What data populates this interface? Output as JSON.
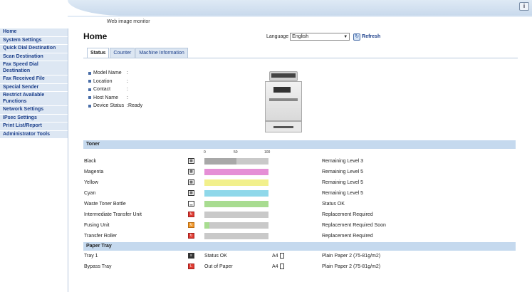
{
  "header": {
    "title": "Web image monitor",
    "help": "i"
  },
  "sidebar": {
    "items": [
      {
        "label": "Home"
      },
      {
        "label": "System Settings"
      },
      {
        "label": "Quick Dial Destination"
      },
      {
        "label": "Scan Destination"
      },
      {
        "label": "Fax Speed Dial Destination"
      },
      {
        "label": "Fax Received File"
      },
      {
        "label": "Special Sender"
      },
      {
        "label": "Restrict Available Functions"
      },
      {
        "label": "Network Settings"
      },
      {
        "label": "IPsec Settings"
      },
      {
        "label": "Print List/Report"
      },
      {
        "label": "Administrator Tools"
      }
    ]
  },
  "page": {
    "title": "Home"
  },
  "language": {
    "label": "Language",
    "selected": "English",
    "refresh": "Refresh"
  },
  "tabs": [
    {
      "label": "Status"
    },
    {
      "label": "Counter"
    },
    {
      "label": "Machine Information"
    }
  ],
  "device": {
    "model_name_label": "Model Name",
    "location_label": "Location",
    "contact_label": "Contact",
    "host_name_label": "Host Name",
    "device_status_label": "Device Status",
    "device_status_value": ":Ready"
  },
  "toner": {
    "header": "Toner",
    "scale": [
      "0",
      "50",
      "100"
    ],
    "rows": [
      {
        "name": "Black",
        "status": "Remaining Level 3",
        "level": 0.5,
        "color": "#a8a8a8",
        "icon": "toner-icon"
      },
      {
        "name": "Magenta",
        "status": "Remaining Level 5",
        "level": 1.0,
        "color": "#e58fd6",
        "icon": "toner-icon"
      },
      {
        "name": "Yellow",
        "status": "Remaining Level 5",
        "level": 1.0,
        "color": "#f2f08c",
        "icon": "toner-icon"
      },
      {
        "name": "Cyan",
        "status": "Remaining Level 5",
        "level": 1.0,
        "color": "#8fd8ea",
        "icon": "toner-icon"
      },
      {
        "name": "Waste Toner Bottle",
        "status": "Status OK",
        "level": 1.0,
        "color": "#a8dc90",
        "icon": "waste-bottle-icon"
      },
      {
        "name": "Intermediate Transfer Unit",
        "status": "Replacement Required",
        "level": 0,
        "color": "#a8dc90",
        "icon": "replace-warning-icon"
      },
      {
        "name": "Fusing Unit",
        "status": "Replacement Required Soon",
        "level": 0.08,
        "color": "#a8dc90",
        "icon": "replace-soon-icon"
      },
      {
        "name": "Transfer Roller",
        "status": "Replacement Required",
        "level": 0,
        "color": "#a8dc90",
        "icon": "replace-warning-icon"
      }
    ]
  },
  "paper_tray": {
    "header": "Paper Tray",
    "rows": [
      {
        "name": "Tray 1",
        "status": "Status OK",
        "size": "A4",
        "paper": "Plain Paper 2 (75-81g/m2)",
        "icon": "tray-ok-icon"
      },
      {
        "name": "Bypass Tray",
        "status": "Out of Paper",
        "size": "A4",
        "paper": "Plain Paper 2 (75-81g/m2)",
        "icon": "tray-empty-icon"
      }
    ]
  },
  "colors": {
    "accent": "#1c3f8a",
    "section_header": "#c5d9ee",
    "sidebar_item": "#dde7f3"
  }
}
